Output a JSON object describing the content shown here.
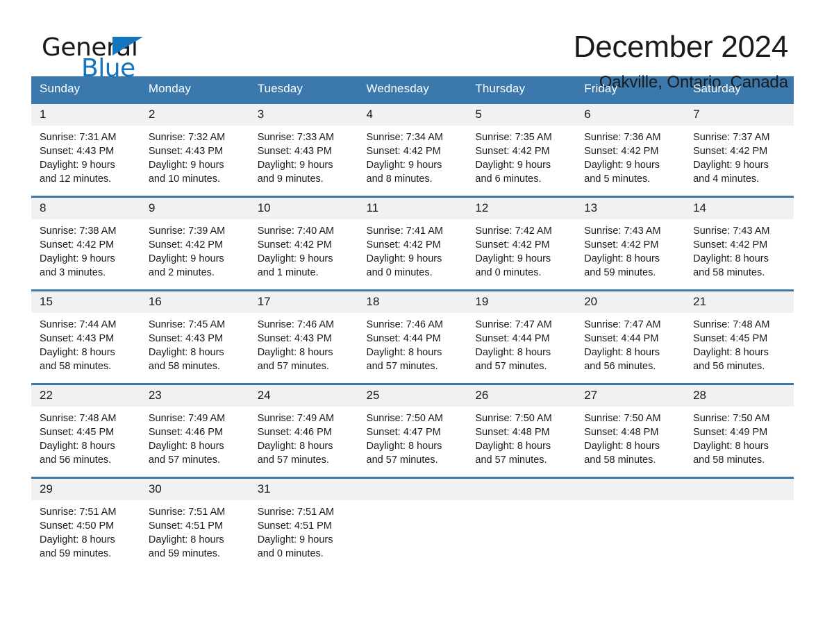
{
  "brand": {
    "word_one": "General",
    "word_two": "Blue",
    "flag_icon": "triangle-flag-icon",
    "accent_color": "#1474bd"
  },
  "header": {
    "month_title": "December 2024",
    "location": "Oakville, Ontario, Canada",
    "header_bg_color": "#3b78ac",
    "daynum_bg_color": "#f1f1f1"
  },
  "weekday_headers": [
    "Sunday",
    "Monday",
    "Tuesday",
    "Wednesday",
    "Thursday",
    "Friday",
    "Saturday"
  ],
  "weeks": [
    {
      "days": [
        {
          "num": "1",
          "sunrise": "Sunrise: 7:31 AM",
          "sunset": "Sunset: 4:43 PM",
          "daylight_1": "Daylight: 9 hours",
          "daylight_2": "and 12 minutes."
        },
        {
          "num": "2",
          "sunrise": "Sunrise: 7:32 AM",
          "sunset": "Sunset: 4:43 PM",
          "daylight_1": "Daylight: 9 hours",
          "daylight_2": "and 10 minutes."
        },
        {
          "num": "3",
          "sunrise": "Sunrise: 7:33 AM",
          "sunset": "Sunset: 4:43 PM",
          "daylight_1": "Daylight: 9 hours",
          "daylight_2": "and 9 minutes."
        },
        {
          "num": "4",
          "sunrise": "Sunrise: 7:34 AM",
          "sunset": "Sunset: 4:42 PM",
          "daylight_1": "Daylight: 9 hours",
          "daylight_2": "and 8 minutes."
        },
        {
          "num": "5",
          "sunrise": "Sunrise: 7:35 AM",
          "sunset": "Sunset: 4:42 PM",
          "daylight_1": "Daylight: 9 hours",
          "daylight_2": "and 6 minutes."
        },
        {
          "num": "6",
          "sunrise": "Sunrise: 7:36 AM",
          "sunset": "Sunset: 4:42 PM",
          "daylight_1": "Daylight: 9 hours",
          "daylight_2": "and 5 minutes."
        },
        {
          "num": "7",
          "sunrise": "Sunrise: 7:37 AM",
          "sunset": "Sunset: 4:42 PM",
          "daylight_1": "Daylight: 9 hours",
          "daylight_2": "and 4 minutes."
        }
      ]
    },
    {
      "days": [
        {
          "num": "8",
          "sunrise": "Sunrise: 7:38 AM",
          "sunset": "Sunset: 4:42 PM",
          "daylight_1": "Daylight: 9 hours",
          "daylight_2": "and 3 minutes."
        },
        {
          "num": "9",
          "sunrise": "Sunrise: 7:39 AM",
          "sunset": "Sunset: 4:42 PM",
          "daylight_1": "Daylight: 9 hours",
          "daylight_2": "and 2 minutes."
        },
        {
          "num": "10",
          "sunrise": "Sunrise: 7:40 AM",
          "sunset": "Sunset: 4:42 PM",
          "daylight_1": "Daylight: 9 hours",
          "daylight_2": "and 1 minute."
        },
        {
          "num": "11",
          "sunrise": "Sunrise: 7:41 AM",
          "sunset": "Sunset: 4:42 PM",
          "daylight_1": "Daylight: 9 hours",
          "daylight_2": "and 0 minutes."
        },
        {
          "num": "12",
          "sunrise": "Sunrise: 7:42 AM",
          "sunset": "Sunset: 4:42 PM",
          "daylight_1": "Daylight: 9 hours",
          "daylight_2": "and 0 minutes."
        },
        {
          "num": "13",
          "sunrise": "Sunrise: 7:43 AM",
          "sunset": "Sunset: 4:42 PM",
          "daylight_1": "Daylight: 8 hours",
          "daylight_2": "and 59 minutes."
        },
        {
          "num": "14",
          "sunrise": "Sunrise: 7:43 AM",
          "sunset": "Sunset: 4:42 PM",
          "daylight_1": "Daylight: 8 hours",
          "daylight_2": "and 58 minutes."
        }
      ]
    },
    {
      "days": [
        {
          "num": "15",
          "sunrise": "Sunrise: 7:44 AM",
          "sunset": "Sunset: 4:43 PM",
          "daylight_1": "Daylight: 8 hours",
          "daylight_2": "and 58 minutes."
        },
        {
          "num": "16",
          "sunrise": "Sunrise: 7:45 AM",
          "sunset": "Sunset: 4:43 PM",
          "daylight_1": "Daylight: 8 hours",
          "daylight_2": "and 58 minutes."
        },
        {
          "num": "17",
          "sunrise": "Sunrise: 7:46 AM",
          "sunset": "Sunset: 4:43 PM",
          "daylight_1": "Daylight: 8 hours",
          "daylight_2": "and 57 minutes."
        },
        {
          "num": "18",
          "sunrise": "Sunrise: 7:46 AM",
          "sunset": "Sunset: 4:44 PM",
          "daylight_1": "Daylight: 8 hours",
          "daylight_2": "and 57 minutes."
        },
        {
          "num": "19",
          "sunrise": "Sunrise: 7:47 AM",
          "sunset": "Sunset: 4:44 PM",
          "daylight_1": "Daylight: 8 hours",
          "daylight_2": "and 57 minutes."
        },
        {
          "num": "20",
          "sunrise": "Sunrise: 7:47 AM",
          "sunset": "Sunset: 4:44 PM",
          "daylight_1": "Daylight: 8 hours",
          "daylight_2": "and 56 minutes."
        },
        {
          "num": "21",
          "sunrise": "Sunrise: 7:48 AM",
          "sunset": "Sunset: 4:45 PM",
          "daylight_1": "Daylight: 8 hours",
          "daylight_2": "and 56 minutes."
        }
      ]
    },
    {
      "days": [
        {
          "num": "22",
          "sunrise": "Sunrise: 7:48 AM",
          "sunset": "Sunset: 4:45 PM",
          "daylight_1": "Daylight: 8 hours",
          "daylight_2": "and 56 minutes."
        },
        {
          "num": "23",
          "sunrise": "Sunrise: 7:49 AM",
          "sunset": "Sunset: 4:46 PM",
          "daylight_1": "Daylight: 8 hours",
          "daylight_2": "and 57 minutes."
        },
        {
          "num": "24",
          "sunrise": "Sunrise: 7:49 AM",
          "sunset": "Sunset: 4:46 PM",
          "daylight_1": "Daylight: 8 hours",
          "daylight_2": "and 57 minutes."
        },
        {
          "num": "25",
          "sunrise": "Sunrise: 7:50 AM",
          "sunset": "Sunset: 4:47 PM",
          "daylight_1": "Daylight: 8 hours",
          "daylight_2": "and 57 minutes."
        },
        {
          "num": "26",
          "sunrise": "Sunrise: 7:50 AM",
          "sunset": "Sunset: 4:48 PM",
          "daylight_1": "Daylight: 8 hours",
          "daylight_2": "and 57 minutes."
        },
        {
          "num": "27",
          "sunrise": "Sunrise: 7:50 AM",
          "sunset": "Sunset: 4:48 PM",
          "daylight_1": "Daylight: 8 hours",
          "daylight_2": "and 58 minutes."
        },
        {
          "num": "28",
          "sunrise": "Sunrise: 7:50 AM",
          "sunset": "Sunset: 4:49 PM",
          "daylight_1": "Daylight: 8 hours",
          "daylight_2": "and 58 minutes."
        }
      ]
    },
    {
      "days": [
        {
          "num": "29",
          "sunrise": "Sunrise: 7:51 AM",
          "sunset": "Sunset: 4:50 PM",
          "daylight_1": "Daylight: 8 hours",
          "daylight_2": "and 59 minutes."
        },
        {
          "num": "30",
          "sunrise": "Sunrise: 7:51 AM",
          "sunset": "Sunset: 4:51 PM",
          "daylight_1": "Daylight: 8 hours",
          "daylight_2": "and 59 minutes."
        },
        {
          "num": "31",
          "sunrise": "Sunrise: 7:51 AM",
          "sunset": "Sunset: 4:51 PM",
          "daylight_1": "Daylight: 9 hours",
          "daylight_2": "and 0 minutes."
        },
        {
          "num": "",
          "sunrise": "",
          "sunset": "",
          "daylight_1": "",
          "daylight_2": ""
        },
        {
          "num": "",
          "sunrise": "",
          "sunset": "",
          "daylight_1": "",
          "daylight_2": ""
        },
        {
          "num": "",
          "sunrise": "",
          "sunset": "",
          "daylight_1": "",
          "daylight_2": ""
        },
        {
          "num": "",
          "sunrise": "",
          "sunset": "",
          "daylight_1": "",
          "daylight_2": ""
        }
      ]
    }
  ]
}
